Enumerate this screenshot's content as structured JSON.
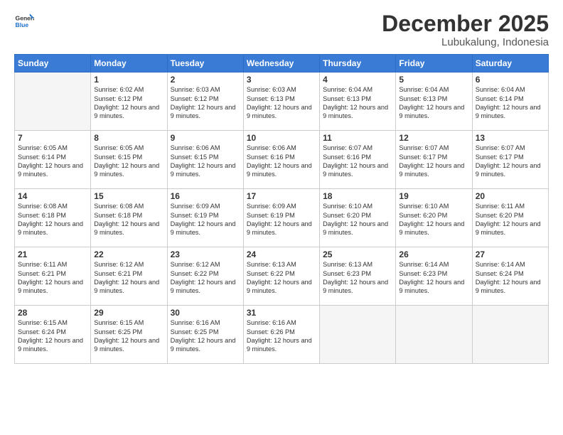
{
  "header": {
    "logo_general": "General",
    "logo_blue": "Blue",
    "month": "December 2025",
    "location": "Lubukalung, Indonesia"
  },
  "weekdays": [
    "Sunday",
    "Monday",
    "Tuesday",
    "Wednesday",
    "Thursday",
    "Friday",
    "Saturday"
  ],
  "days": [
    {
      "day": "",
      "empty": true
    },
    {
      "day": "1",
      "sunrise": "6:02 AM",
      "sunset": "6:12 PM",
      "daylight": "12 hours and 9 minutes."
    },
    {
      "day": "2",
      "sunrise": "6:03 AM",
      "sunset": "6:12 PM",
      "daylight": "12 hours and 9 minutes."
    },
    {
      "day": "3",
      "sunrise": "6:03 AM",
      "sunset": "6:13 PM",
      "daylight": "12 hours and 9 minutes."
    },
    {
      "day": "4",
      "sunrise": "6:04 AM",
      "sunset": "6:13 PM",
      "daylight": "12 hours and 9 minutes."
    },
    {
      "day": "5",
      "sunrise": "6:04 AM",
      "sunset": "6:13 PM",
      "daylight": "12 hours and 9 minutes."
    },
    {
      "day": "6",
      "sunrise": "6:04 AM",
      "sunset": "6:14 PM",
      "daylight": "12 hours and 9 minutes."
    },
    {
      "day": "7",
      "sunrise": "6:05 AM",
      "sunset": "6:14 PM",
      "daylight": "12 hours and 9 minutes."
    },
    {
      "day": "8",
      "sunrise": "6:05 AM",
      "sunset": "6:15 PM",
      "daylight": "12 hours and 9 minutes."
    },
    {
      "day": "9",
      "sunrise": "6:06 AM",
      "sunset": "6:15 PM",
      "daylight": "12 hours and 9 minutes."
    },
    {
      "day": "10",
      "sunrise": "6:06 AM",
      "sunset": "6:16 PM",
      "daylight": "12 hours and 9 minutes."
    },
    {
      "day": "11",
      "sunrise": "6:07 AM",
      "sunset": "6:16 PM",
      "daylight": "12 hours and 9 minutes."
    },
    {
      "day": "12",
      "sunrise": "6:07 AM",
      "sunset": "6:17 PM",
      "daylight": "12 hours and 9 minutes."
    },
    {
      "day": "13",
      "sunrise": "6:07 AM",
      "sunset": "6:17 PM",
      "daylight": "12 hours and 9 minutes."
    },
    {
      "day": "14",
      "sunrise": "6:08 AM",
      "sunset": "6:18 PM",
      "daylight": "12 hours and 9 minutes."
    },
    {
      "day": "15",
      "sunrise": "6:08 AM",
      "sunset": "6:18 PM",
      "daylight": "12 hours and 9 minutes."
    },
    {
      "day": "16",
      "sunrise": "6:09 AM",
      "sunset": "6:19 PM",
      "daylight": "12 hours and 9 minutes."
    },
    {
      "day": "17",
      "sunrise": "6:09 AM",
      "sunset": "6:19 PM",
      "daylight": "12 hours and 9 minutes."
    },
    {
      "day": "18",
      "sunrise": "6:10 AM",
      "sunset": "6:20 PM",
      "daylight": "12 hours and 9 minutes."
    },
    {
      "day": "19",
      "sunrise": "6:10 AM",
      "sunset": "6:20 PM",
      "daylight": "12 hours and 9 minutes."
    },
    {
      "day": "20",
      "sunrise": "6:11 AM",
      "sunset": "6:20 PM",
      "daylight": "12 hours and 9 minutes."
    },
    {
      "day": "21",
      "sunrise": "6:11 AM",
      "sunset": "6:21 PM",
      "daylight": "12 hours and 9 minutes."
    },
    {
      "day": "22",
      "sunrise": "6:12 AM",
      "sunset": "6:21 PM",
      "daylight": "12 hours and 9 minutes."
    },
    {
      "day": "23",
      "sunrise": "6:12 AM",
      "sunset": "6:22 PM",
      "daylight": "12 hours and 9 minutes."
    },
    {
      "day": "24",
      "sunrise": "6:13 AM",
      "sunset": "6:22 PM",
      "daylight": "12 hours and 9 minutes."
    },
    {
      "day": "25",
      "sunrise": "6:13 AM",
      "sunset": "6:23 PM",
      "daylight": "12 hours and 9 minutes."
    },
    {
      "day": "26",
      "sunrise": "6:14 AM",
      "sunset": "6:23 PM",
      "daylight": "12 hours and 9 minutes."
    },
    {
      "day": "27",
      "sunrise": "6:14 AM",
      "sunset": "6:24 PM",
      "daylight": "12 hours and 9 minutes."
    },
    {
      "day": "28",
      "sunrise": "6:15 AM",
      "sunset": "6:24 PM",
      "daylight": "12 hours and 9 minutes."
    },
    {
      "day": "29",
      "sunrise": "6:15 AM",
      "sunset": "6:25 PM",
      "daylight": "12 hours and 9 minutes."
    },
    {
      "day": "30",
      "sunrise": "6:16 AM",
      "sunset": "6:25 PM",
      "daylight": "12 hours and 9 minutes."
    },
    {
      "day": "31",
      "sunrise": "6:16 AM",
      "sunset": "6:26 PM",
      "daylight": "12 hours and 9 minutes."
    }
  ]
}
